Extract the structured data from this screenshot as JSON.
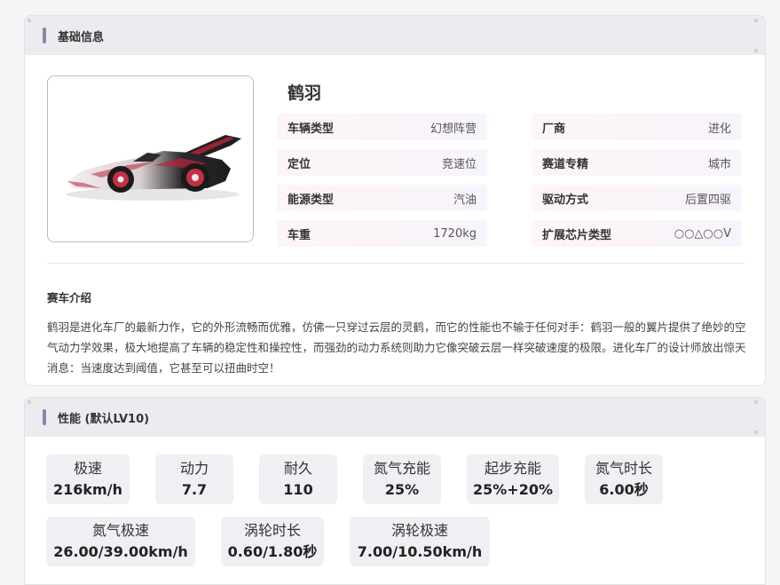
{
  "basic": {
    "header": "基础信息",
    "car_name": "鹤羽",
    "attributes": [
      {
        "label": "车辆类型",
        "value": "幻想阵营"
      },
      {
        "label": "厂商",
        "value": "进化"
      },
      {
        "label": "定位",
        "value": "竞速位"
      },
      {
        "label": "赛道专精",
        "value": "城市"
      },
      {
        "label": "能源类型",
        "value": "汽油"
      },
      {
        "label": "驱动方式",
        "value": "后置四驱"
      },
      {
        "label": "车重",
        "value": "1720kg"
      },
      {
        "label": "扩展芯片类型",
        "value": "○○△○○V"
      }
    ],
    "intro_title": "赛车介绍",
    "intro_text": "鹤羽是进化车厂的最新力作，它的外形流畅而优雅，仿佛一只穿过云层的灵鹤，而它的性能也不输于任何对手：鹤羽一般的翼片提供了绝妙的空气动力学效果，极大地提高了车辆的稳定性和操控性，而强劲的动力系统则助力它像突破云层一样突破速度的极限。进化车厂的设计师放出惊天消息：当速度达到阈值，它甚至可以扭曲时空！"
  },
  "performance": {
    "header": "性能 (默认LV10)",
    "stats": [
      {
        "label": "极速",
        "value": "216km/h"
      },
      {
        "label": "动力",
        "value": "7.7"
      },
      {
        "label": "耐久",
        "value": "110"
      },
      {
        "label": "氮气充能",
        "value": "25%"
      },
      {
        "label": "起步充能",
        "value": "25%+20%"
      },
      {
        "label": "氮气时长",
        "value": "6.00秒"
      },
      {
        "label": "氮气极速",
        "value": "26.00/39.00km/h"
      },
      {
        "label": "涡轮时长",
        "value": "0.60/1.80秒"
      },
      {
        "label": "涡轮极速",
        "value": "7.00/10.50km/h"
      }
    ]
  },
  "colors": {
    "accent_bar": "#8a86a8",
    "header_bg": "#ececf0",
    "stat_bg": "#eef0f3",
    "car_red": "#b8253a"
  }
}
